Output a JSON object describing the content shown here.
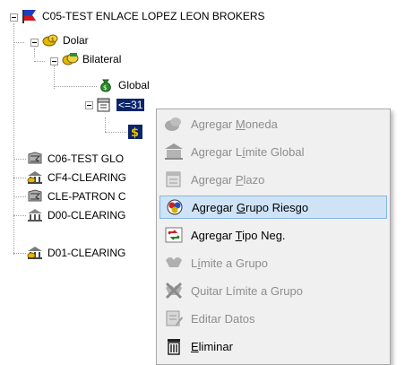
{
  "tree": {
    "root": {
      "label": "C05-TEST ENLACE LOPEZ LEON BROKERS",
      "icon": "entity-flag-icon"
    },
    "currency": {
      "label": "Dolar",
      "icon": "currency-dolar-icon"
    },
    "bilateral": {
      "label": "Bilateral",
      "icon": "bilateral-handshake-icon"
    },
    "global": {
      "label": "Global",
      "icon": "money-bag-icon"
    },
    "term": {
      "label": "<=31",
      "icon": "calendar-icon"
    },
    "term_child": {
      "label": "",
      "icon": "dollar-icon"
    },
    "others": [
      {
        "label": "C06-TEST GLO",
        "icon": "entity-icon"
      },
      {
        "label": "CF4-CLEARING",
        "icon": "bank-icon"
      },
      {
        "label": "CLE-PATRON C",
        "icon": "entity-icon"
      },
      {
        "label": "D00-CLEARING",
        "icon": "bank-building-icon"
      },
      {
        "label": "D01-CLEARING",
        "icon": "bank-icon"
      }
    ]
  },
  "context_menu": {
    "items": [
      {
        "pre": "Agregar ",
        "ul": "M",
        "post": "oneda",
        "enabled": false,
        "icon": "add-currency-icon"
      },
      {
        "pre": "Agregar L",
        "ul": "í",
        "post": "mite Global",
        "enabled": false,
        "icon": "add-global-limit-icon"
      },
      {
        "pre": "Agregar ",
        "ul": "P",
        "post": "lazo",
        "enabled": false,
        "icon": "add-term-icon"
      },
      {
        "pre": "Agregar ",
        "ul": "G",
        "post": "rupo Riesgo",
        "enabled": true,
        "highlighted": true,
        "icon": "risk-group-icon"
      },
      {
        "pre": "Agregar ",
        "ul": "T",
        "post": "ipo Neg.",
        "enabled": true,
        "icon": "deal-type-icon"
      },
      {
        "pre": "L",
        "ul": "í",
        "post": "mite a Grupo",
        "enabled": false,
        "icon": "group-limit-icon"
      },
      {
        "pre": "Quitar Límite a Grupo",
        "ul": "",
        "post": "",
        "enabled": false,
        "icon": "remove-group-limit-icon"
      },
      {
        "pre": "Editar Datos",
        "ul": "",
        "post": "",
        "enabled": false,
        "icon": "edit-data-icon"
      },
      {
        "pre": "",
        "ul": "E",
        "post": "liminar",
        "enabled": true,
        "icon": "trash-icon"
      }
    ]
  },
  "colors": {
    "selection": "#0a246a",
    "menu_bg": "#f0f0f0",
    "highlight": "#cfe3f7"
  }
}
